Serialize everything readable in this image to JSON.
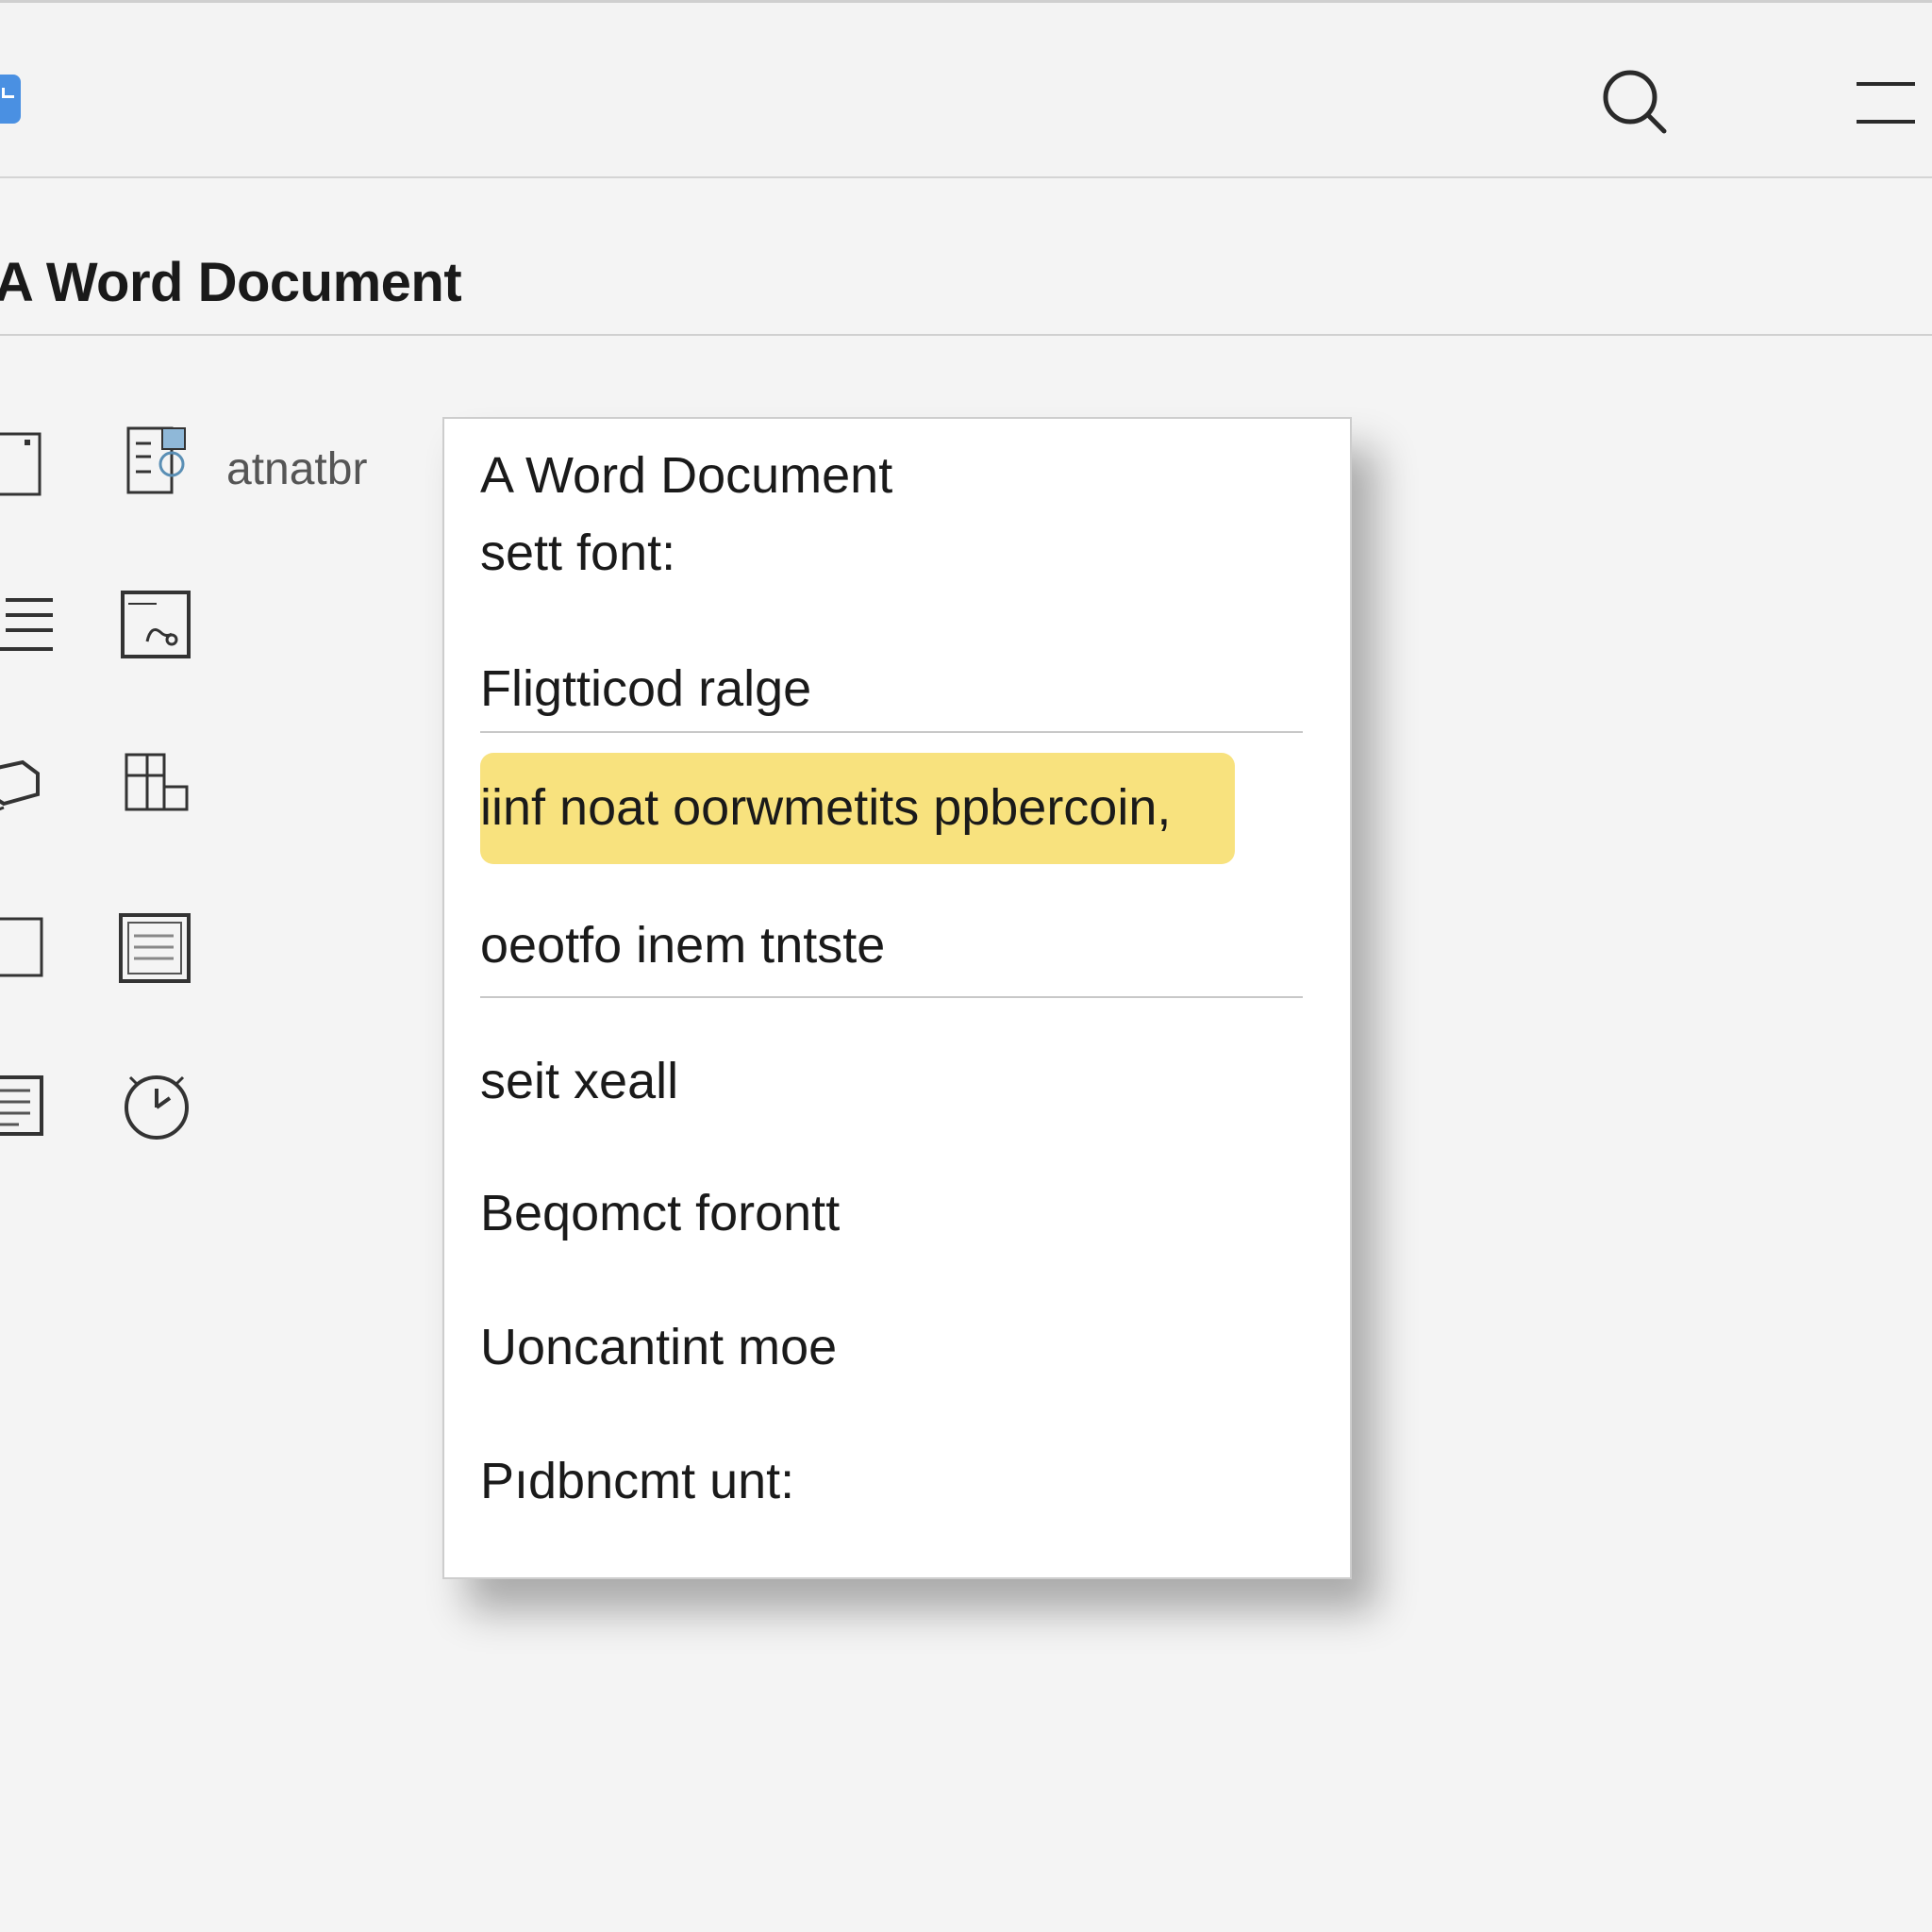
{
  "toolbar": {
    "logo_icon": "app-logo-icon",
    "search_icon": "search-icon",
    "menu_icon": "hamburger-menu-icon"
  },
  "document": {
    "title": "A Word Document"
  },
  "sidebar": {
    "label": "atnatbr",
    "icons": [
      "page-icon",
      "document-settings-icon",
      "list-icon",
      "image-frame-icon",
      "layers-icon",
      "grid-blocks-icon",
      "blank-frame-icon",
      "table-icon",
      "notes-icon",
      "clock-icon"
    ]
  },
  "dropdown": {
    "header": "A Word Document",
    "subheader": "sett font:",
    "items": [
      "Fligtticod ralge",
      "iinf noat oorwmetits ppbercoin,",
      "oeotfo inem tntste",
      "seit xeall",
      "Beqomct forontt",
      "Uoncantint moe",
      "Pıdbncmt unt:"
    ],
    "highlighted_index": 1,
    "highlight_color": "#f8e27e"
  }
}
